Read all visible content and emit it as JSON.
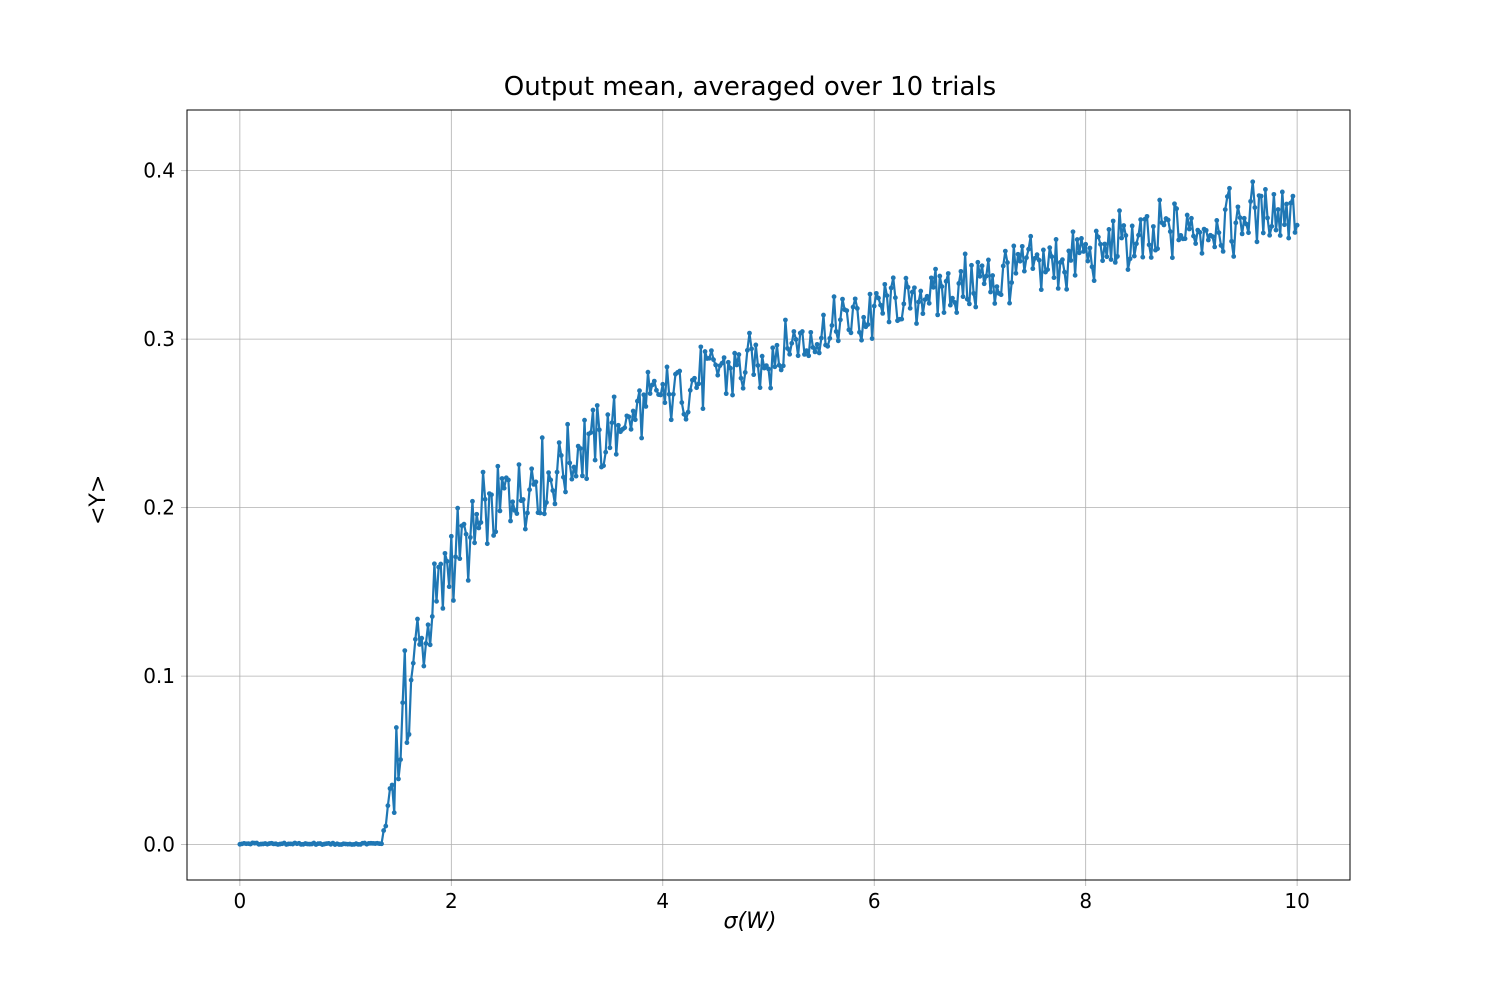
{
  "chart_data": {
    "type": "line",
    "title": "Output mean, averaged over 10 trials",
    "xlabel": "σ(W)",
    "ylabel": "<Y>",
    "xlim": [
      -0.5,
      10.5
    ],
    "ylim": [
      -0.021,
      0.436
    ],
    "xticks": [
      0,
      2,
      4,
      6,
      8,
      10
    ],
    "yticks": [
      0.0,
      0.1,
      0.2,
      0.3,
      0.4
    ],
    "color": "#1f77b4",
    "n_points": 501,
    "x_start": 0.0,
    "x_end": 10.0,
    "x_step": 0.02,
    "flat_until_index": 67,
    "trend_anchors": {
      "x": [
        1.34,
        1.5,
        1.7,
        2.0,
        2.5,
        3.0,
        3.5,
        4.0,
        5.0,
        6.0,
        7.0,
        8.0,
        9.0,
        10.0
      ],
      "y": [
        0.0,
        0.06,
        0.12,
        0.17,
        0.205,
        0.225,
        0.243,
        0.265,
        0.29,
        0.315,
        0.335,
        0.35,
        0.365,
        0.378
      ]
    },
    "noise_amp_anchors": {
      "x": [
        1.34,
        1.5,
        2.0,
        3.0,
        5.0,
        10.0
      ],
      "a": [
        0.0,
        0.04,
        0.03,
        0.023,
        0.02,
        0.02
      ]
    },
    "y_extremes_approx": {
      "min": 0.0,
      "max": 0.415
    },
    "series_name": "<Y>"
  },
  "labels": {
    "title": "Output mean, averaged over 10 trials",
    "xlabel_sigma": "σ",
    "xlabel_W": "W",
    "ylabel": "<Y>",
    "xtick_labels": [
      "0",
      "2",
      "4",
      "6",
      "8",
      "10"
    ],
    "ytick_labels": [
      "0.0",
      "0.1",
      "0.2",
      "0.3",
      "0.4"
    ]
  }
}
